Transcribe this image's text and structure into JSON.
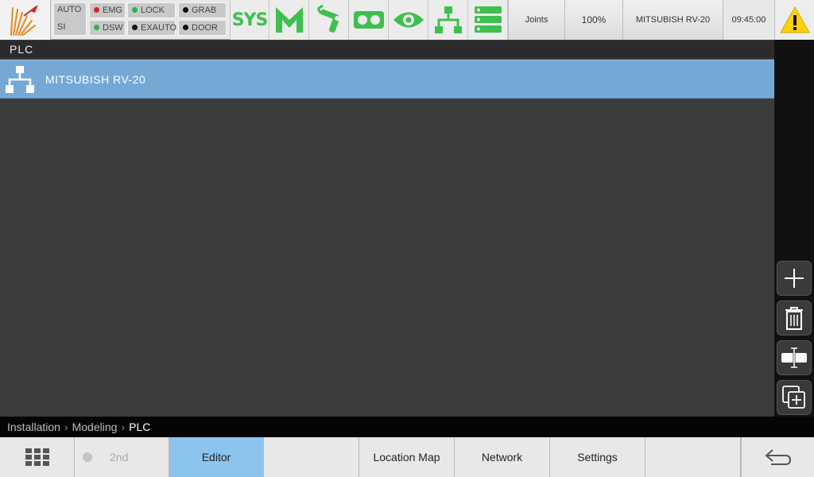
{
  "topbar": {
    "status_indicators": [
      {
        "label": "AUTO",
        "color": ""
      },
      {
        "label": "SI",
        "color": ""
      },
      {
        "label": "EMG",
        "color": "#e02020"
      },
      {
        "label": "DSW",
        "color": "#2cb34a"
      },
      {
        "label": "LOCK",
        "color": "#2cb34a"
      },
      {
        "label": "EXAUTO",
        "color": "#111111"
      },
      {
        "label": "GRAB",
        "color": "#111111"
      },
      {
        "label": "DOOR",
        "color": "#111111"
      }
    ],
    "sys_label": "SYS",
    "tool_icons": [
      "sys-icon",
      "modeling-icon",
      "robot-arm-icon",
      "tape-icon",
      "vision-eye-icon",
      "network-tree-icon",
      "server-list-icon"
    ],
    "joints_label": "Joints",
    "speed_label": "100%",
    "robot_label": "MITSUBISH RV-20",
    "time_label": "09:45:00",
    "warning_icon": "warning-icon",
    "accent_green": "#3ec04e"
  },
  "main": {
    "heading": "PLC",
    "rows": [
      {
        "label": "MITSUBISH RV-20",
        "icon": "network-tree-icon",
        "selected": true
      }
    ]
  },
  "side_buttons": [
    "add-icon",
    "trash-icon",
    "rename-icon",
    "duplicate-icon"
  ],
  "breadcrumb": {
    "items": [
      "Installation",
      "Modeling"
    ],
    "current": "PLC"
  },
  "bottombar": {
    "second_label": "2nd",
    "tabs": [
      "Editor",
      "Location Map",
      "Network",
      "Settings"
    ],
    "active_tab": "Editor"
  },
  "colors": {
    "selection": "#76a8d6",
    "active_tab": "#8cc4ee",
    "warning": "#ffd200"
  }
}
